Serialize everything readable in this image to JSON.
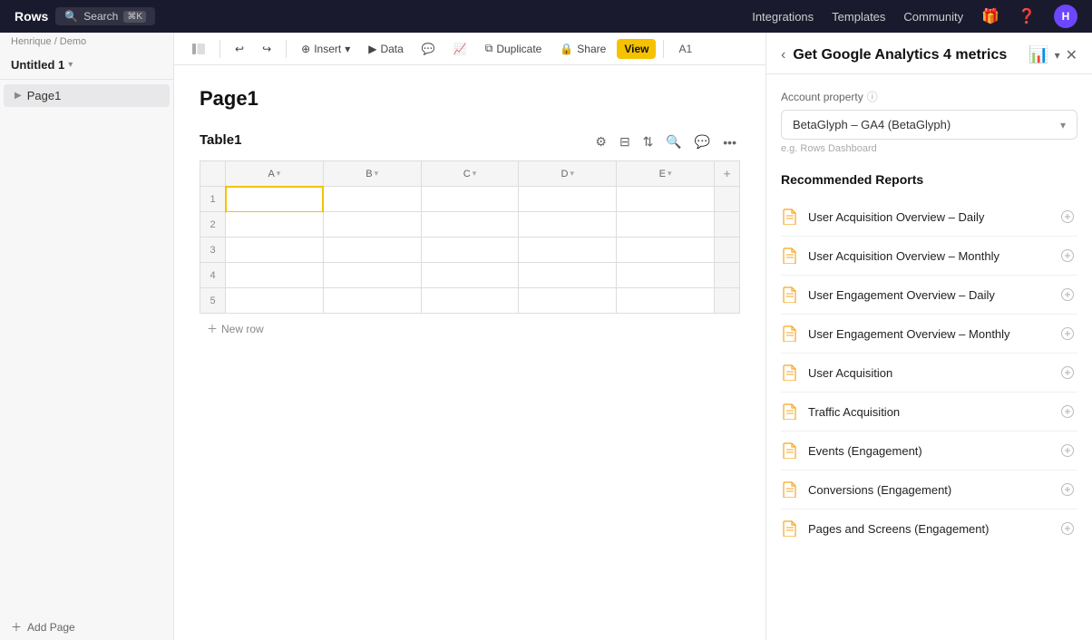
{
  "app": {
    "brand": "Rows",
    "search_label": "Search",
    "search_kbd": "⌘K"
  },
  "topnav": {
    "items": [
      {
        "id": "integrations",
        "label": "Integrations"
      },
      {
        "id": "templates",
        "label": "Templates"
      },
      {
        "id": "community",
        "label": "Community"
      }
    ],
    "avatar_letter": "H"
  },
  "breadcrumb": "Henrique / Demo",
  "sidebar": {
    "title": "Untitled 1",
    "pages": [
      {
        "id": "page1",
        "label": "Page1",
        "active": true
      }
    ],
    "add_page_label": "Add Page"
  },
  "toolbar": {
    "undo_label": "↩",
    "redo_label": "↪",
    "insert_label": "Insert",
    "data_label": "Data",
    "duplicate_label": "Duplicate",
    "share_label": "Share",
    "view_label": "View",
    "cell_ref": "A1"
  },
  "page": {
    "title": "Page1",
    "table_name": "Table1",
    "columns": [
      "A",
      "B",
      "C",
      "D",
      "E"
    ],
    "rows": [
      1,
      2,
      3,
      4,
      5
    ],
    "new_row_label": "New row"
  },
  "panel": {
    "title": "Get Google Analytics 4 metrics",
    "emoji": "📊",
    "account_property_label": "Account property",
    "account_property_help": "?",
    "account_value": "BetaGlyph – GA4 (BetaGlyph)",
    "account_hint": "e.g. Rows Dashboard",
    "recommended_title": "Recommended Reports",
    "reports": [
      {
        "id": "user-acq-daily",
        "name": "User Acquisition Overview – Daily"
      },
      {
        "id": "user-acq-monthly",
        "name": "User Acquisition Overview – Monthly"
      },
      {
        "id": "user-eng-daily",
        "name": "User Engagement Overview – Daily"
      },
      {
        "id": "user-eng-monthly",
        "name": "User Engagement Overview – Monthly"
      },
      {
        "id": "user-acquisition",
        "name": "User Acquisition"
      },
      {
        "id": "traffic-acquisition",
        "name": "Traffic Acquisition"
      },
      {
        "id": "events-engagement",
        "name": "Events (Engagement)"
      },
      {
        "id": "conversions-engagement",
        "name": "Conversions (Engagement)"
      },
      {
        "id": "pages-screens",
        "name": "Pages and Screens (Engagement)"
      }
    ]
  }
}
